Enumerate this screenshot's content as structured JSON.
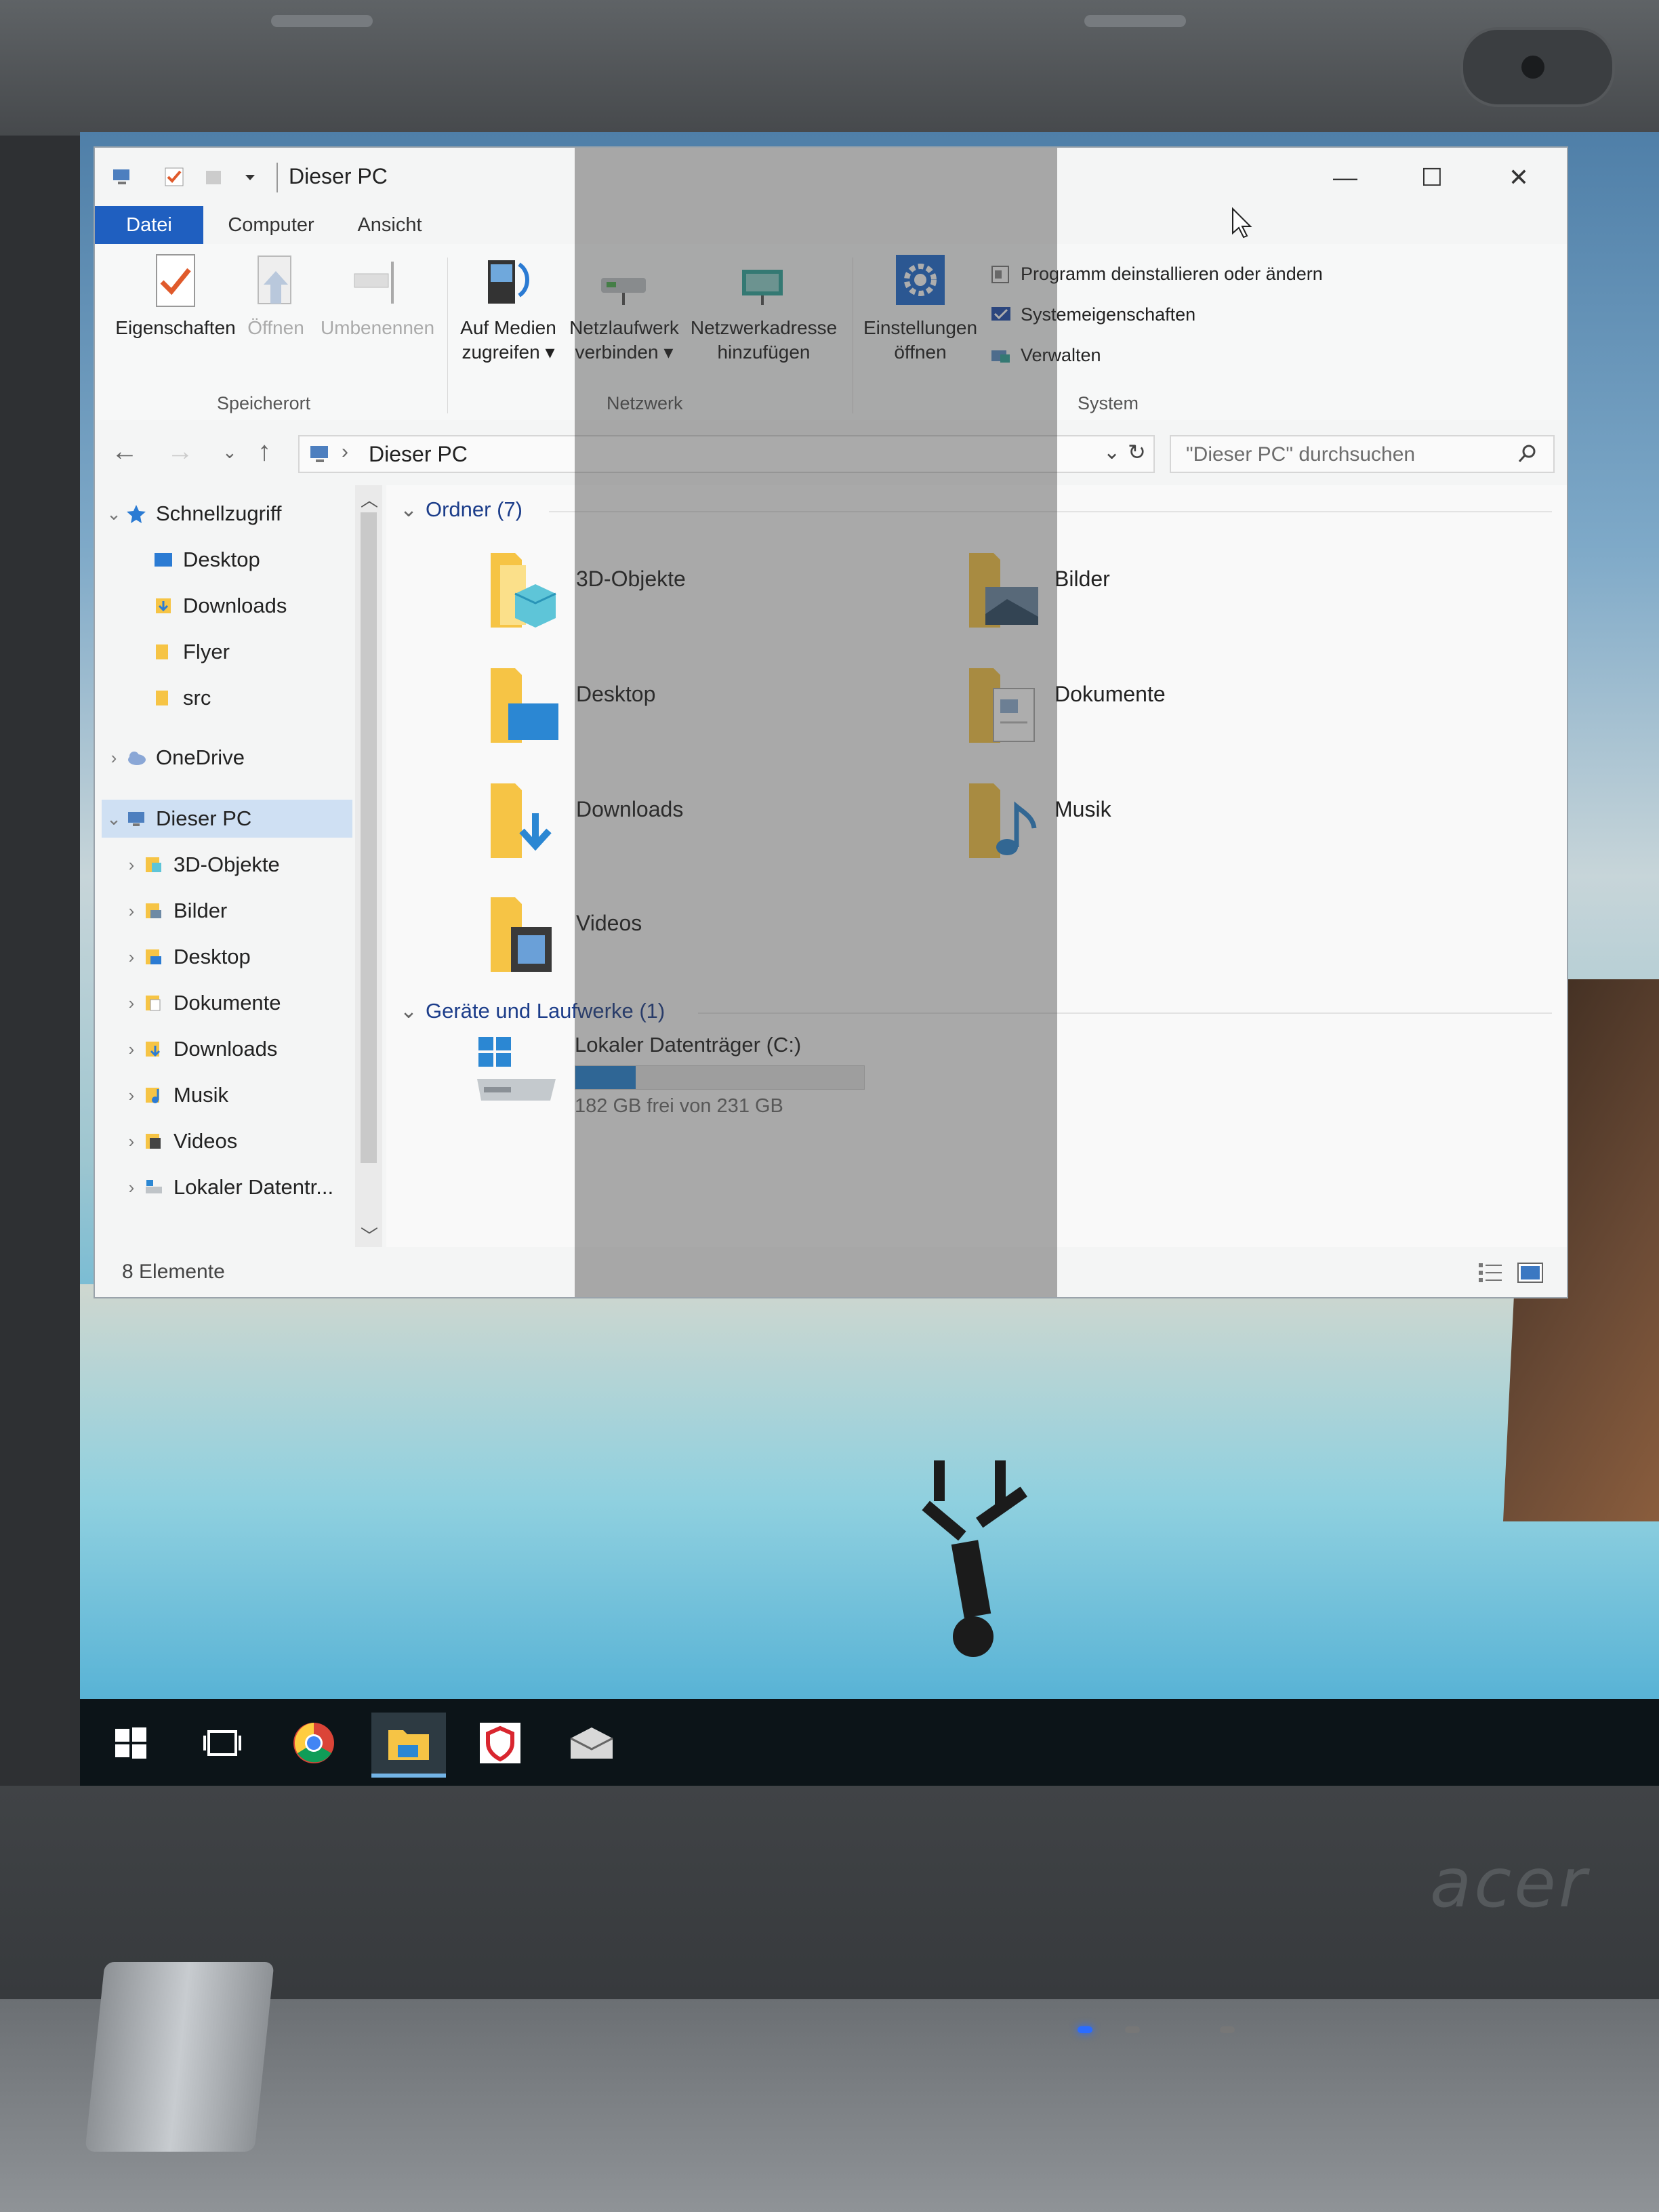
{
  "window": {
    "title": "Dieser PC",
    "controls": {
      "minimize": "—",
      "maximize": "☐",
      "close": "✕"
    }
  },
  "menu": {
    "tabs": [
      "Datei",
      "Computer",
      "Ansicht"
    ],
    "help": "?"
  },
  "ribbon": {
    "location_group": {
      "label": "Speicherort",
      "buttons": [
        "Eigenschaften",
        "Öffnen",
        "Umbenennen"
      ]
    },
    "network_group": {
      "label": "Netzwerk",
      "buttons": [
        {
          "line1": "Auf Medien",
          "line2": "zugreifen ▾"
        },
        {
          "line1": "Netzlaufwerk",
          "line2": "verbinden ▾"
        },
        {
          "line1": "Netzwerkadresse",
          "line2": "hinzufügen"
        }
      ]
    },
    "system_group": {
      "label": "System",
      "settings": {
        "line1": "Einstellungen",
        "line2": "öffnen"
      },
      "items": [
        "Programm deinstallieren oder ändern",
        "Systemeigenschaften",
        "Verwalten"
      ]
    }
  },
  "address": {
    "path": "Dieser PC",
    "search_placeholder": "\"Dieser PC\" durchsuchen"
  },
  "nav": {
    "quick_access": "Schnellzugriff",
    "quick_items": [
      "Desktop",
      "Downloads",
      "Flyer",
      "src"
    ],
    "onedrive": "OneDrive",
    "this_pc": "Dieser PC",
    "pc_items": [
      "3D-Objekte",
      "Bilder",
      "Desktop",
      "Dokumente",
      "Downloads",
      "Musik",
      "Videos",
      "Lokaler Datentr..."
    ]
  },
  "content": {
    "folders_header": "Ordner (7)",
    "folders": [
      "3D-Objekte",
      "Bilder",
      "Desktop",
      "Dokumente",
      "Downloads",
      "Musik",
      "Videos"
    ],
    "devices_header": "Geräte und Laufwerke (1)",
    "drive": {
      "name": "Lokaler Datenträger (C:)",
      "free_text": "182 GB frei von 231 GB",
      "used_fraction": 0.21
    }
  },
  "status": {
    "count": "8 Elemente"
  },
  "brand": "acer",
  "colors": {
    "accent": "#1f5fc0",
    "selection": "#cfe0f3",
    "taskbar": "#0c1418"
  }
}
